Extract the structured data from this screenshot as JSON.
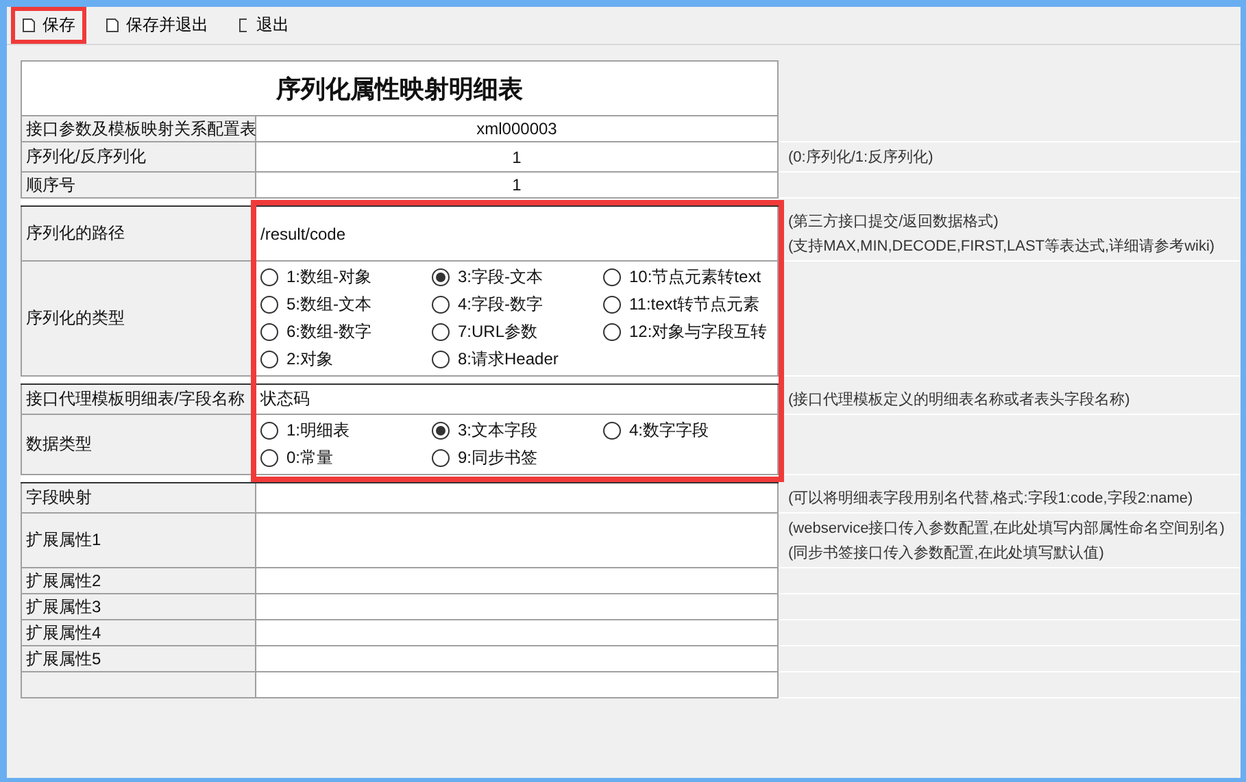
{
  "toolbar": [
    {
      "kind": "save",
      "label": "保存",
      "highlighted": true
    },
    {
      "kind": "save",
      "label": "保存并退出",
      "highlighted": false
    },
    {
      "kind": "exit",
      "label": "退出",
      "highlighted": false
    }
  ],
  "title": "序列化属性映射明细表",
  "sections": [
    {
      "highlighted": false,
      "rows": [
        {
          "kind": "value",
          "label": "接口参数及模板映射关系配置表",
          "value": "xml000003",
          "notes": []
        },
        {
          "kind": "value",
          "label": "序列化/反序列化",
          "value": "1",
          "notes": [
            "(0:序列化/1:反序列化)"
          ]
        },
        {
          "kind": "value",
          "label": "顺序号",
          "value": "1",
          "notes": []
        }
      ]
    },
    {
      "highlighted": true,
      "rows": [
        {
          "kind": "input",
          "label": "序列化的路径",
          "value": "/result/code",
          "notes": [
            "(第三方接口提交/返回数据格式)",
            "(支持MAX,MIN,DECODE,FIRST,LAST等表达式,详细请参考wiki)"
          ]
        },
        {
          "kind": "radios",
          "label": "序列化的类型",
          "notes": [],
          "options": [
            {
              "label": "1:数组-对象",
              "selected": false
            },
            {
              "label": "3:字段-文本",
              "selected": true
            },
            {
              "label": "10:节点元素转text",
              "selected": false
            },
            {
              "label": "5:数组-文本",
              "selected": false
            },
            {
              "label": "4:字段-数字",
              "selected": false
            },
            {
              "label": "11:text转节点元素",
              "selected": false
            },
            {
              "label": "6:数组-数字",
              "selected": false
            },
            {
              "label": "7:URL参数",
              "selected": false
            },
            {
              "label": "12:对象与字段互转",
              "selected": false
            },
            {
              "label": "2:对象",
              "selected": false
            },
            {
              "label": "8:请求Header",
              "selected": false
            }
          ]
        },
        {
          "kind": "gap"
        },
        {
          "kind": "input",
          "label": "接口代理模板明细表/字段名称",
          "value": "状态码",
          "notes": [
            "(接口代理模板定义的明细表名称或者表头字段名称)"
          ]
        },
        {
          "kind": "radios",
          "label": "数据类型",
          "notes": [],
          "options": [
            {
              "label": "1:明细表",
              "selected": false
            },
            {
              "label": "3:文本字段",
              "selected": true
            },
            {
              "label": "4:数字字段",
              "selected": false
            },
            {
              "label": "0:常量",
              "selected": false
            },
            {
              "label": "9:同步书签",
              "selected": false
            }
          ]
        }
      ]
    },
    {
      "highlighted": false,
      "rows": [
        {
          "kind": "input",
          "label": "字段映射",
          "value": "",
          "notes": [
            "(可以将明细表字段用别名代替,格式:字段1:code,字段2:name)"
          ]
        },
        {
          "kind": "input",
          "label": "扩展属性1",
          "value": "",
          "notes": [
            "(webservice接口传入参数配置,在此处填写内部属性命名空间别名)",
            "(同步书签接口传入参数配置,在此处填写默认值)"
          ]
        },
        {
          "kind": "input",
          "label": "扩展属性2",
          "value": "",
          "notes": []
        },
        {
          "kind": "input",
          "label": "扩展属性3",
          "value": "",
          "notes": []
        },
        {
          "kind": "input",
          "label": "扩展属性4",
          "value": "",
          "notes": []
        },
        {
          "kind": "input",
          "label": "扩展属性5",
          "value": "",
          "notes": []
        },
        {
          "kind": "input",
          "label": "",
          "value": "",
          "notes": []
        }
      ]
    }
  ]
}
